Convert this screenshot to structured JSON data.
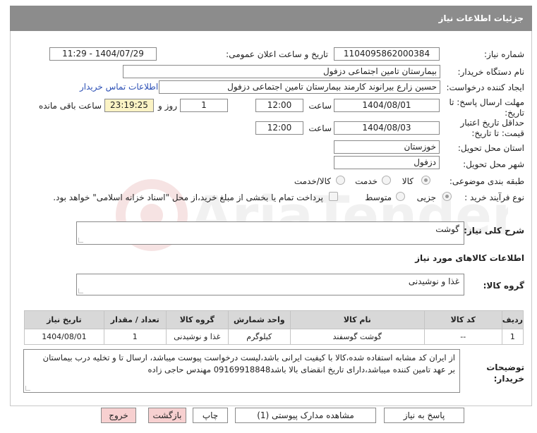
{
  "header": {
    "title": "جزئیات اطلاعات نیاز"
  },
  "form": {
    "need_number_label": "شماره نیاز:",
    "need_number": "1104095862000384",
    "announce_label": "تاریخ و ساعت اعلان عمومی:",
    "announce_value": "1404/07/29 - 11:29",
    "buyer_org_label": "نام دستگاه خریدار:",
    "buyer_org": "بیمارستان تامین اجتماعی دزفول",
    "requester_label": "ایجاد کننده درخواست:",
    "requester": "حسین زارع بیرانوند کارمند بیمارستان تامین اجتماعی دزفول",
    "contact_link": "اطلاعات تماس خریدار",
    "deadline_label_1": "مهلت ارسال پاسخ: تا",
    "deadline_label_2": "تاریخ:",
    "deadline_date": "1404/08/01",
    "time_label": "ساعت",
    "deadline_time": "12:00",
    "days_value": "1",
    "days_label": "روز و",
    "remaining_time": "23:19:25",
    "remaining_label": "ساعت باقی مانده",
    "validity_label_1": "حداقل تاریخ اعتبار",
    "validity_label_2": "قیمت: تا تاریخ:",
    "validity_date": "1404/08/03",
    "validity_time": "12:00",
    "province_label": "استان محل تحویل:",
    "province": "خوزستان",
    "city_label": "شهر محل تحویل:",
    "city": "دزفول",
    "category_label": "طبقه بندی موضوعی:",
    "category_options": [
      "کالا",
      "خدمت",
      "کالا/خدمت"
    ],
    "process_label": "نوع فرآیند خرید :",
    "process_options": [
      "جزیی",
      "متوسط"
    ],
    "payment_note": "پرداخت تمام یا بخشی از مبلغ خرید،از محل \"اسناد خزانه اسلامی\" خواهد بود."
  },
  "summary": {
    "label": "شرح کلی نیاز:",
    "value": "گوشت"
  },
  "goods": {
    "section_title": "اطلاعات کالاهای مورد نیاز",
    "group_label": "گروه کالا:",
    "group_value": "غذا و نوشیدنی",
    "columns": [
      "ردیف",
      "کد کالا",
      "نام کالا",
      "واحد شمارش",
      "گروه کالا",
      "تعداد / مقدار",
      "تاریخ نیاز"
    ],
    "rows": [
      [
        "1",
        "--",
        "گوشت گوسفند",
        "کیلوگرم",
        "غذا و نوشیدنی",
        "1",
        "1404/08/01"
      ]
    ]
  },
  "buyer_notes": {
    "label_1": "توضیحات",
    "label_2": "خریدار:",
    "line_1": "از ایران کد مشابه استفاده شده،کالا با کیفیت ایرانی باشد،لیست درخواست پیوست میباشد، ارسال تا و تخلیه درب بیماستان",
    "line_2": "بر عهد تامین کننده میباشد،دارای تاریخ انقضای بالا باشد09169918848 مهندس حاجی زاده"
  },
  "buttons": {
    "reply": "پاسخ به نیاز",
    "attachments": "مشاهده مدارک پیوستی (1)",
    "print": "چاپ",
    "back": "بازگشت",
    "exit": "خروج"
  },
  "colors": {
    "header_bg": "#8c8c8c",
    "link": "#2b4fb5",
    "highlight": "#fbf3c4",
    "exit_bg": "#f7d0d0"
  }
}
